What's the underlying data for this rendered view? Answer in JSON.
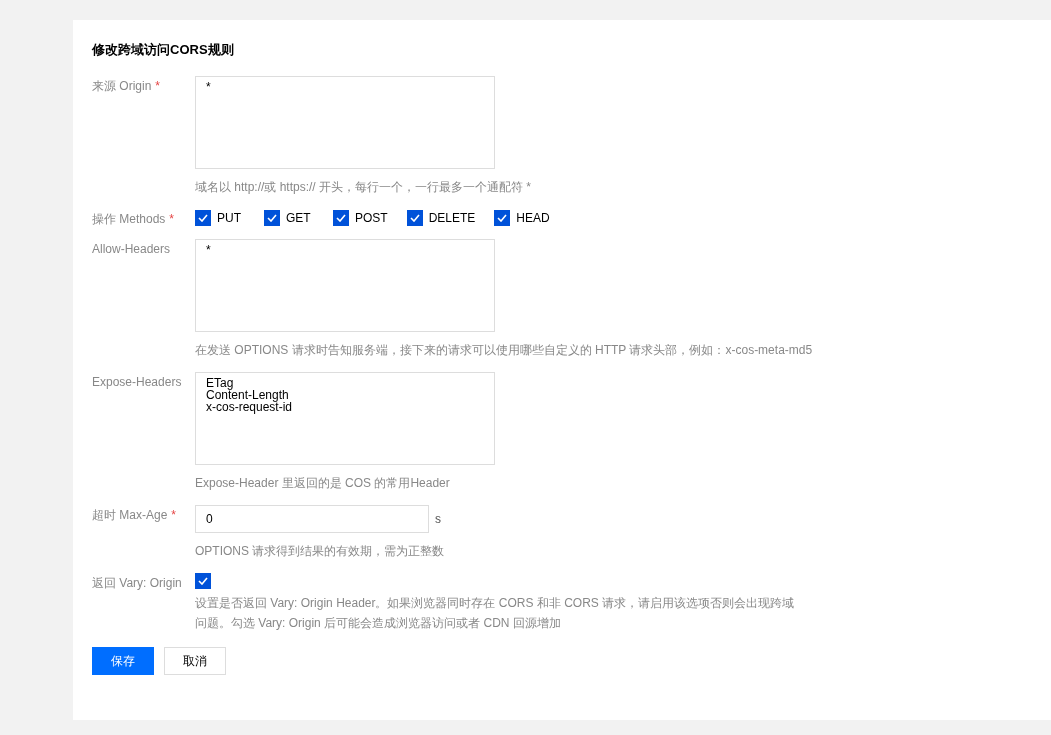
{
  "title": "修改跨域访问CORS规则",
  "fields": [
    {
      "kind": "textarea",
      "label": "来源 Origin",
      "required_mark": "*",
      "value": "*",
      "hint": "域名以 http://或 https:// 开头，每行一个，一行最多一个通配符 *"
    },
    {
      "kind": "checkboxes",
      "label": "操作 Methods",
      "required_mark": "*",
      "options": [
        {
          "label": "PUT",
          "checked": true
        },
        {
          "label": "GET",
          "checked": true
        },
        {
          "label": "POST",
          "checked": true
        },
        {
          "label": "DELETE",
          "checked": true
        },
        {
          "label": "HEAD",
          "checked": true
        }
      ]
    },
    {
      "kind": "textarea",
      "label": "Allow-Headers",
      "value": "*",
      "hint": "在发送 OPTIONS 请求时告知服务端，接下来的请求可以使用哪些自定义的 HTTP 请求头部，例如：x-cos-meta-md5"
    },
    {
      "kind": "textarea",
      "label": "Expose-Headers",
      "value": "ETag\nContent-Length\nx-cos-request-id",
      "hint": "Expose-Header 里返回的是 COS 的常用Header"
    },
    {
      "kind": "number",
      "label": "超时 Max-Age",
      "required_mark": "*",
      "value": "0",
      "unit": "s",
      "hint": "OPTIONS 请求得到结果的有效期，需为正整数"
    },
    {
      "kind": "checkbox",
      "label": "返回 Vary: Origin",
      "checked": true,
      "hint": "设置是否返回 Vary: Origin Header。如果浏览器同时存在 CORS 和非 CORS 请求，请启用该选项否则会出现跨域问题。勾选 Vary: Origin 后可能会造成浏览器访问或者 CDN 回源增加"
    }
  ],
  "buttons": [
    {
      "label": "保存",
      "kind": "primary"
    },
    {
      "label": "取消",
      "kind": "secondary"
    }
  ]
}
